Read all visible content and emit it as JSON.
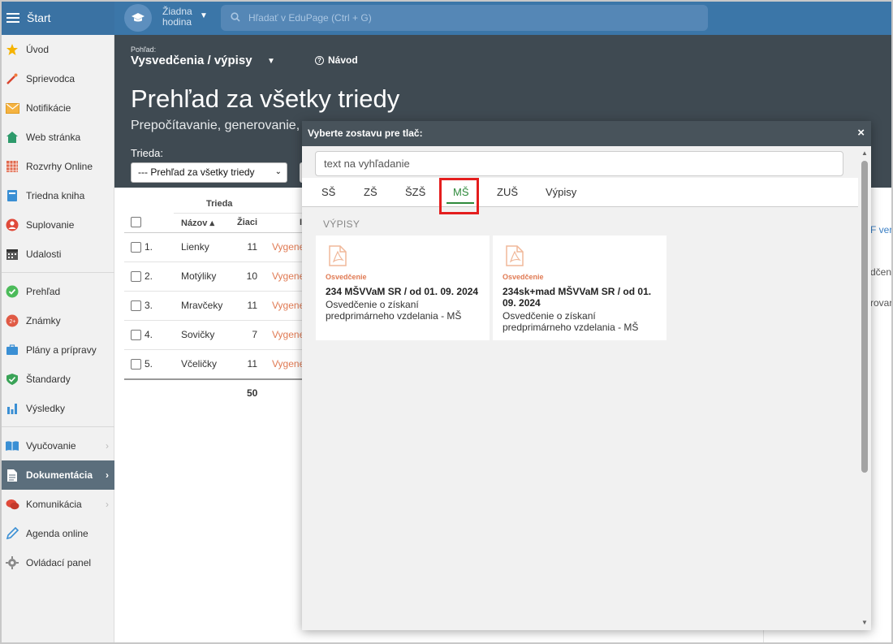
{
  "topbar": {
    "start_label": "Štart",
    "hour_line1": "Žiadna",
    "hour_line2": "hodina",
    "search_placeholder": "Hľadať v EduPage (Ctrl + G)"
  },
  "sidebar": {
    "items": [
      {
        "label": "Úvod",
        "icon": "star-icon"
      },
      {
        "label": "Sprievodca",
        "icon": "magic-wand-icon"
      },
      {
        "label": "Notifikácie",
        "icon": "envelope-icon"
      },
      {
        "label": "Web stránka",
        "icon": "home-icon"
      },
      {
        "label": "Rozvrhy Online",
        "icon": "timetable-icon"
      },
      {
        "label": "Triedna kniha",
        "icon": "book-icon"
      },
      {
        "label": "Suplovanie",
        "icon": "person-icon"
      },
      {
        "label": "Udalosti",
        "icon": "calendar-icon"
      },
      {
        "label": "Prehľad",
        "icon": "check-circle-icon"
      },
      {
        "label": "Známky",
        "icon": "grade-icon"
      },
      {
        "label": "Plány a prípravy",
        "icon": "briefcase-icon"
      },
      {
        "label": "Štandardy",
        "icon": "shield-check-icon"
      },
      {
        "label": "Výsledky",
        "icon": "bar-chart-icon"
      },
      {
        "label": "Vyučovanie",
        "icon": "open-book-icon"
      },
      {
        "label": "Dokumentácia",
        "icon": "document-icon"
      },
      {
        "label": "Komunikácia",
        "icon": "chat-icon"
      },
      {
        "label": "Agenda online",
        "icon": "pen-icon"
      },
      {
        "label": "Ovládací panel",
        "icon": "gear-icon"
      }
    ]
  },
  "header": {
    "view_label": "Pohľad:",
    "view_title": "Vysvedčenia / výpisy",
    "guide_label": "Návod",
    "page_title": "Prehľad za všetky triedy",
    "page_subtitle": "Prepočítavanie, generovanie,",
    "class_label": "Trieda:",
    "class_select_value": "--- Prehľad za všetky triedy"
  },
  "table": {
    "group_header": "Trieda",
    "col_name": "Názov ▴",
    "col_students": "Žiaci",
    "col_partial": "I",
    "rows": [
      {
        "no": "1.",
        "name": "Lienky",
        "students": "11",
        "status": "Vygene"
      },
      {
        "no": "2.",
        "name": "Motýliky",
        "students": "10",
        "status": "Vygene"
      },
      {
        "no": "3.",
        "name": "Mravčeky",
        "students": "11",
        "status": "Vygene"
      },
      {
        "no": "4.",
        "name": "Sovičky",
        "students": "7",
        "status": "Vygene"
      },
      {
        "no": "5.",
        "name": "Včeličky",
        "students": "11",
        "status": "Vygene"
      }
    ],
    "total": "50"
  },
  "right_fragments": {
    "a": "F ver",
    "b": "dčeni",
    "c": "rovar"
  },
  "modal": {
    "title": "Vyberte zostavu pre tlač:",
    "close": "×",
    "search_placeholder": "text na vyhľadanie",
    "tabs": [
      "SŠ",
      "ZŠ",
      "ŠZŠ",
      "MŠ",
      "ZUŠ",
      "Výpisy"
    ],
    "active_tab": "MŠ",
    "section_label": "VÝPISY",
    "cards": [
      {
        "kind": "Osvedčenie",
        "title": "234 MŠVVaM SR / od 01. 09. 2024",
        "desc": "Osvedčenie o získaní predprimárneho vzdelania - MŠ"
      },
      {
        "kind": "Osvedčenie",
        "title": "234sk+mad MŠVVaM SR / od 01. 09. 2024",
        "desc": "Osvedčenie o získaní predprimárneho vzdelania - MŠ"
      }
    ]
  },
  "colors": {
    "topbar": "#3b76a8",
    "header_dark": "#3f4a52",
    "accent_orange": "#e07a53",
    "active_tab_green": "#2f8a3c",
    "highlight_red": "#e41e1e"
  }
}
